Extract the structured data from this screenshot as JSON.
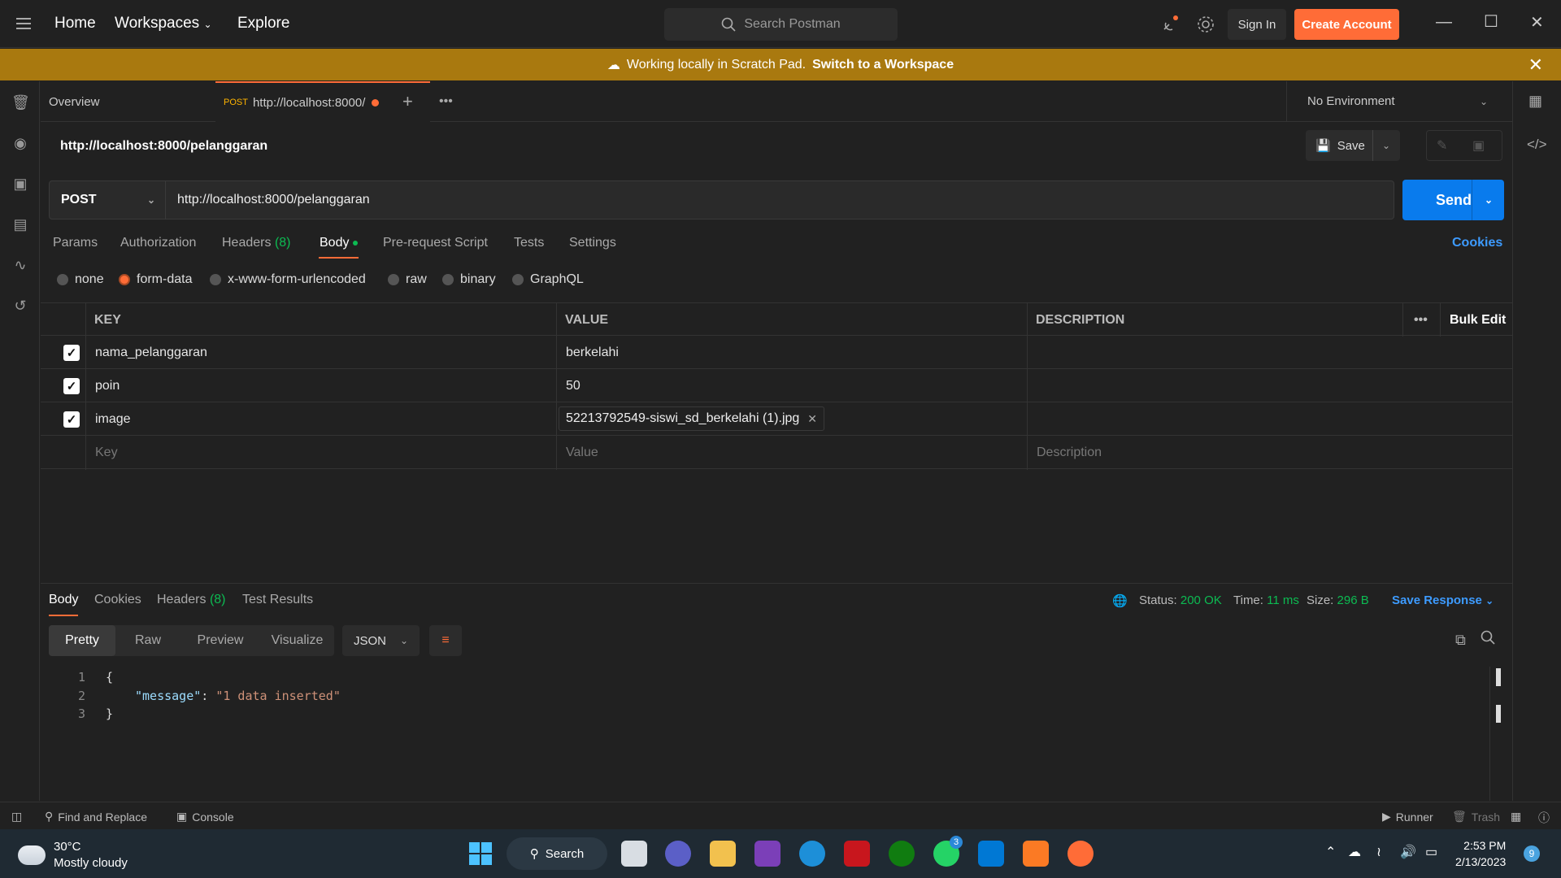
{
  "titlebar": {
    "nav": [
      "Home",
      "Workspaces",
      "Explore"
    ],
    "search_placeholder": "Search Postman",
    "sign_in": "Sign In",
    "create_account": "Create Account"
  },
  "banner": {
    "text": "Working locally in Scratch Pad.",
    "link": "Switch to a Workspace"
  },
  "tabs": {
    "overview": "Overview",
    "active_method": "POST",
    "active_url": "http://localhost:8000/",
    "environment": "No Environment"
  },
  "request": {
    "title": "http://localhost:8000/pelanggaran",
    "save_label": "Save",
    "method": "POST",
    "url": "http://localhost:8000/pelanggaran",
    "send_label": "Send",
    "tabs": [
      "Params",
      "Authorization",
      "Headers",
      "Body",
      "Pre-request Script",
      "Tests",
      "Settings"
    ],
    "headers_count": "(8)",
    "cookies": "Cookies",
    "body_modes": [
      "none",
      "form-data",
      "x-www-form-urlencoded",
      "raw",
      "binary",
      "GraphQL"
    ],
    "selected_body_mode": "form-data"
  },
  "form_table": {
    "headers": [
      "KEY",
      "VALUE",
      "DESCRIPTION"
    ],
    "bulk_edit": "Bulk Edit",
    "rows": [
      {
        "key": "nama_pelanggaran",
        "value": "berkelahi",
        "checked": true
      },
      {
        "key": "poin",
        "value": "50",
        "checked": true
      },
      {
        "key": "image",
        "value": "52213792549-siswi_sd_berkelahi (1).jpg",
        "checked": true,
        "is_file": true
      }
    ],
    "placeholders": {
      "key": "Key",
      "value": "Value",
      "description": "Description"
    }
  },
  "response": {
    "tabs": [
      "Body",
      "Cookies",
      "Headers",
      "Test Results"
    ],
    "headers_count": "(8)",
    "status_label": "Status:",
    "status": "200 OK",
    "time_label": "Time:",
    "time": "11 ms",
    "size_label": "Size:",
    "size": "296 B",
    "save_response": "Save Response",
    "views": [
      "Pretty",
      "Raw",
      "Preview",
      "Visualize"
    ],
    "format": "JSON",
    "code_lines": [
      "1",
      "2",
      "3"
    ],
    "code_open": "{",
    "code_key": "\"message\"",
    "code_sep": ": ",
    "code_value": "\"1 data inserted\"",
    "code_close": "}"
  },
  "statusbar": {
    "find_replace": "Find and Replace",
    "console": "Console",
    "runner": "Runner",
    "trash": "Trash"
  },
  "taskbar": {
    "temperature": "30°C",
    "weather": "Mostly cloudy",
    "search": "Search",
    "time": "2:53 PM",
    "date": "2/13/2023",
    "whatsapp_badge": "3",
    "notifications": "9"
  },
  "colors": {
    "accent": "#ff6c37",
    "send_blue": "#097bed",
    "banner": "#a9790f",
    "success_green": "#0cbb52"
  }
}
